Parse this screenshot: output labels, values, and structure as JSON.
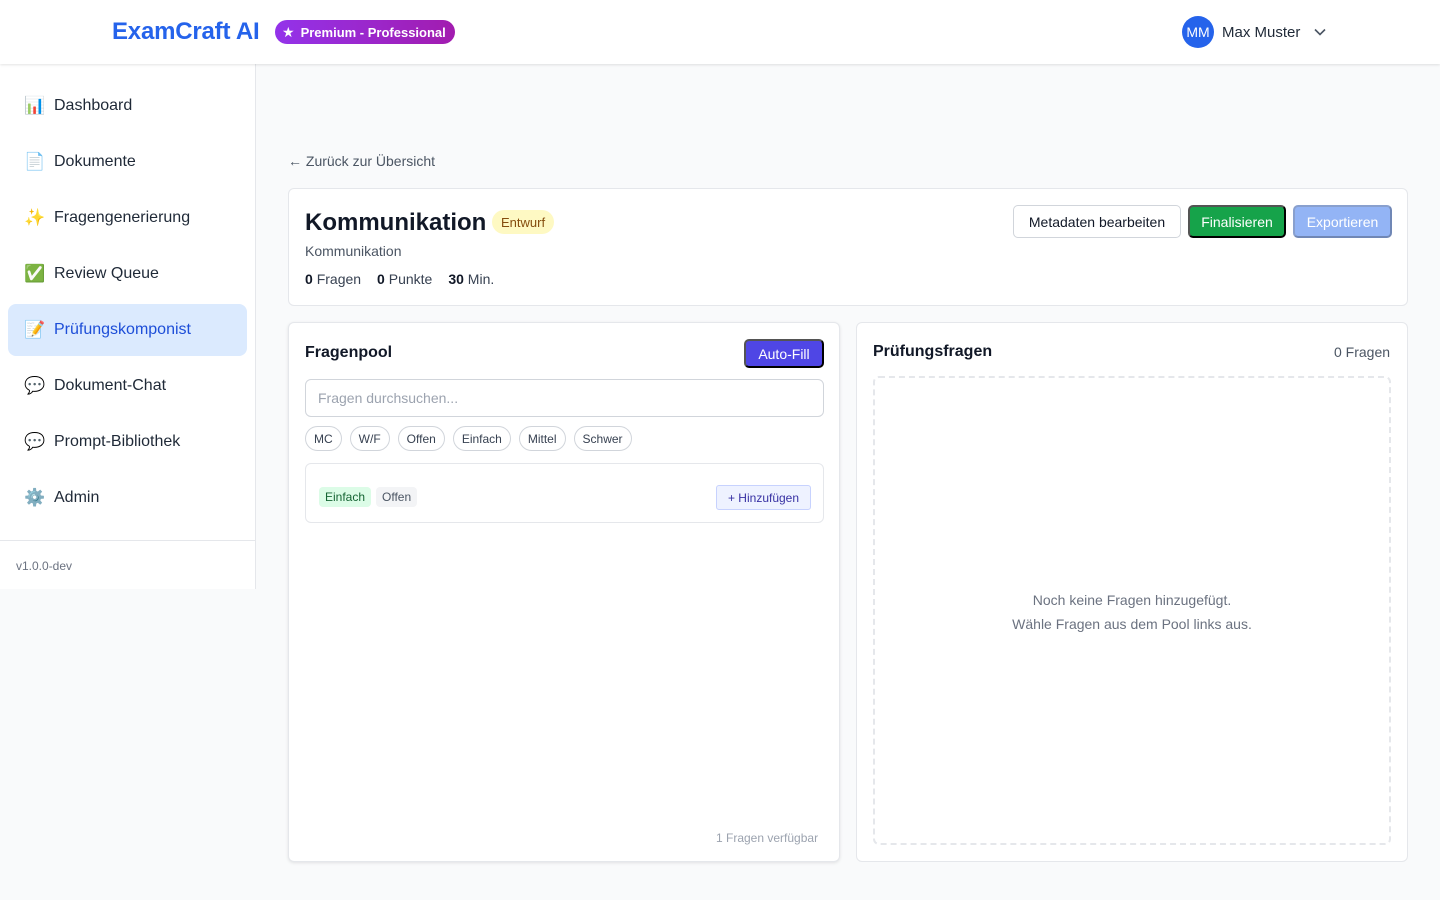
{
  "header": {
    "brand": "ExamCraft AI",
    "plan_badge": "Premium - Professional",
    "user_initials": "MM",
    "user_name": "Max Muster"
  },
  "sidebar": {
    "items": [
      {
        "label": "Dashboard",
        "icon": "📊"
      },
      {
        "label": "Dokumente",
        "icon": "📄"
      },
      {
        "label": "Fragengenerierung",
        "icon": "✨"
      },
      {
        "label": "Review Queue",
        "icon": "✅"
      },
      {
        "label": "Prüfungskomponist",
        "icon": "📝"
      },
      {
        "label": "Dokument-Chat",
        "icon": "💬"
      },
      {
        "label": "Prompt-Bibliothek",
        "icon": "💬"
      },
      {
        "label": "Admin",
        "icon": "⚙️"
      }
    ],
    "active_item": "Prüfungskomponist",
    "version": "v1.0.0-dev"
  },
  "back_link": "← Zurück zur Übersicht",
  "exam": {
    "title": "Kommunikation",
    "status": "Entwurf",
    "subtitle": "Kommunikation",
    "questions_count": "0",
    "questions_label": "Fragen",
    "points_count": "0",
    "points_label": "Punkte",
    "duration": "30",
    "duration_label": "Min.",
    "buttons": {
      "edit_metadata": "Metadaten bearbeiten",
      "finalize": "Finalisieren",
      "export": "Exportieren"
    }
  },
  "pool": {
    "title": "Fragenpool",
    "autofill": "Auto-Fill",
    "search_placeholder": "Fragen durchsuchen...",
    "filters": [
      "MC",
      "W/F",
      "Offen",
      "Einfach",
      "Mittel",
      "Schwer"
    ],
    "questions": [
      {
        "difficulty": "Einfach",
        "type": "Offen",
        "add_label": "+ Hinzufügen"
      }
    ],
    "available": "1 Fragen verfügbar"
  },
  "exam_questions": {
    "title": "Prüfungsfragen",
    "count": "0 Fragen",
    "empty_line1": "Noch keine Fragen hinzugefügt.",
    "empty_line2": "Wähle Fragen aus dem Pool links aus."
  },
  "colors": {
    "brand": "#2563eb",
    "active_nav_bg": "#dbeafe",
    "finalize": "#16a34a",
    "autofill": "#4f46e5",
    "status_bg": "#fef9c3"
  }
}
